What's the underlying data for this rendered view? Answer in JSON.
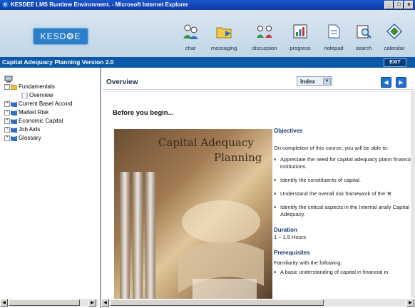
{
  "window": {
    "title": "KESDEE LMS Runtime Environment. - Microsoft Internet Explorer",
    "controls": [
      "_",
      "□",
      "x"
    ]
  },
  "header": {
    "logo": "KESD❂E",
    "tools": [
      {
        "label": "chat",
        "icon": "chat-icon"
      },
      {
        "label": "messaging",
        "icon": "messaging-folder-icon"
      },
      {
        "label": "discussion",
        "icon": "discussion-icon"
      },
      {
        "label": "progress",
        "icon": "progress-icon"
      },
      {
        "label": "notepad",
        "icon": "notepad-icon"
      },
      {
        "label": "search",
        "icon": "search-icon"
      },
      {
        "label": "calendar",
        "icon": "calendar-icon"
      }
    ]
  },
  "coursebar": {
    "title": "Capital Adequacy Planning Version 2.0",
    "exit": "EXIT"
  },
  "tree": {
    "items": [
      {
        "label": "Fundamentals",
        "expanded": true
      },
      {
        "label": "Overview"
      },
      {
        "label": "Current Basel Accord"
      },
      {
        "label": "Market Risk"
      },
      {
        "label": "Economic Capital"
      },
      {
        "label": "Job Aids"
      },
      {
        "label": "Glossary"
      }
    ]
  },
  "content": {
    "page_title": "Overview",
    "index_label": "Index",
    "before_heading": "Before you begin...",
    "cover_line1": "Capital Adequacy",
    "cover_line2": "Planning",
    "objectives_heading": "Objectives",
    "objectives_intro": "On completion of this course, you will be able to:",
    "objectives": [
      "Appreciate the need for capital adequacy plann financial institutions.",
      "Identify the constituents of capital.",
      "Understand the overall risk framework of the 'B",
      "Identify the critical aspects in the Internal analy Capital Adequacy."
    ],
    "duration_heading": "Duration",
    "duration_value": "1 – 1.5 Hours",
    "prereq_heading": "Prerequisites",
    "prereq_intro": "Familiarity with the following:",
    "prereq_partial": "A basic understanding of capital in financial in"
  }
}
